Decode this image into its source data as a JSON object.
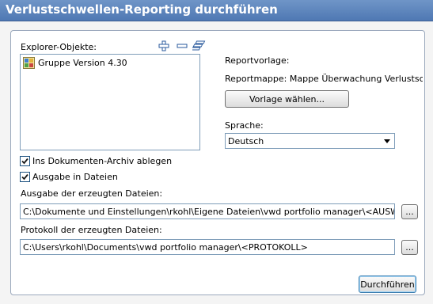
{
  "window": {
    "title": "Verlustschwellen-Reporting durchführen"
  },
  "explorer": {
    "label": "Explorer-Objekte:",
    "items": [
      {
        "label": "Gruppe Version 4.30"
      }
    ],
    "icons": [
      "add-icon",
      "remove-icon",
      "stack-icon"
    ]
  },
  "report": {
    "template_label": "Reportvorlage:",
    "folder_label": "Reportmappe: Mappe Überwachung Verlustschwellen",
    "choose_template_button": "Vorlage wählen..."
  },
  "language": {
    "label": "Sprache:",
    "selected": "Deutsch"
  },
  "options": {
    "archive": {
      "label": "Ins Dokumenten-Archiv ablegen",
      "checked": true
    },
    "files": {
      "label": "Ausgabe in Dateien",
      "checked": true
    }
  },
  "output": {
    "label": "Ausgabe der erzeugten Dateien:",
    "value": "C:\\Dokumente und Einstellungen\\rkohl\\Eigene Dateien\\vwd portfolio manager\\<AUSWERTUNGSDA",
    "browse": "..."
  },
  "protocol": {
    "label": "Protokoll der erzeugten Dateien:",
    "value": "C:\\Users\\rkohl\\Documents\\vwd portfolio manager\\<PROTOKOLL>",
    "browse": "..."
  },
  "actions": {
    "run_button": "Durchführen"
  },
  "colors": {
    "titlebar": "#5a80b8",
    "border": "#7f9db9"
  }
}
